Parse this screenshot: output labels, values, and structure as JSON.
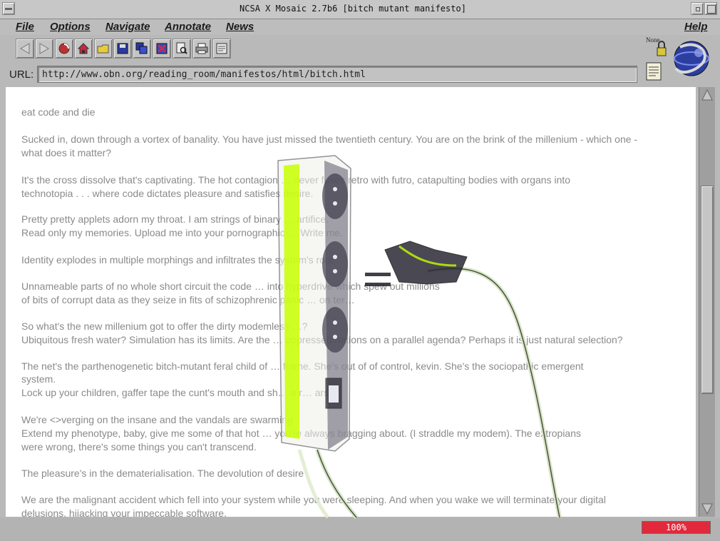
{
  "window": {
    "title": "NCSA X Mosaic 2.7b6 [bitch mutant manifesto]"
  },
  "menu": {
    "file": "File",
    "options": "Options",
    "navigate": "Navigate",
    "annotate": "Annotate",
    "news": "News",
    "help": "Help"
  },
  "toolbar_icons": [
    "back-icon",
    "forward-icon",
    "reload-icon",
    "home-icon",
    "open-icon",
    "save-icon",
    "clone-icon",
    "close-window-icon",
    "find-icon",
    "print-icon",
    "annotate-icon"
  ],
  "corner": {
    "note_label": "None"
  },
  "url": {
    "label": "URL:",
    "value": "http://www.obn.org/reading_room/manifestos/html/bitch.html"
  },
  "content": {
    "lines": [
      "eat code and die",
      "Sucked in, down through a vortex of banality. You have just missed the twentieth century. You are on the brink of the millenium - which one -",
      "what does it matter?",
      "It's the cross dissolve that's captivating. The hot contagion … never fuses retro with futro, catapulting bodies with organs into",
      "technotopia . . . where code dictates pleasure and satisfies desire.",
      "Pretty pretty applets adorn my throat. I am strings of binary … artifice.",
      "Read only my memories. Upload me into your pornographic … Write me.",
      "Identity explodes in multiple morphings and infiltrates the system's root",
      "Unnameable parts of no whole short circuit the code … into hyperdrive which spew out millions",
      "of bits of corrupt data as they seize in fits of schizophrenic panic … on ter…",
      "So what's the new millenium got to offer the dirty modemless …?",
      "Ubiquitous fresh water? Simulation has its limits. Are the … oppressed nations on a parallel agenda? Perhaps it is just natural selection?",
      "The net's the parthenogenetic bitch-mutant feral child of … frame. She's out of of control, kevin. She's the sociopathic emergent",
      "system.",
      "Lock up your children, gaffer tape the cunt's mouth and sh… a r… arse.",
      "We're <>verging on the insane and the vandals are swarming",
      "Extend my phenotype, baby, give me some of that hot … you're always bragging about. (I straddle my modem). The extropians",
      "were wrong, there's some things you can't transcend.",
      "The pleasure's in the dematerialisation. The devolution of desire",
      "We are the malignant accident which fell into your system while you were sleeping. And when you wake we will terminate your digital",
      "delusions, hijacking your impeccable software."
    ]
  },
  "status": {
    "progress_text": "100%",
    "progress_value": 1.0
  },
  "colors": {
    "progress_bar": "#e2293c",
    "strip_highlight": "#c8ff00"
  }
}
